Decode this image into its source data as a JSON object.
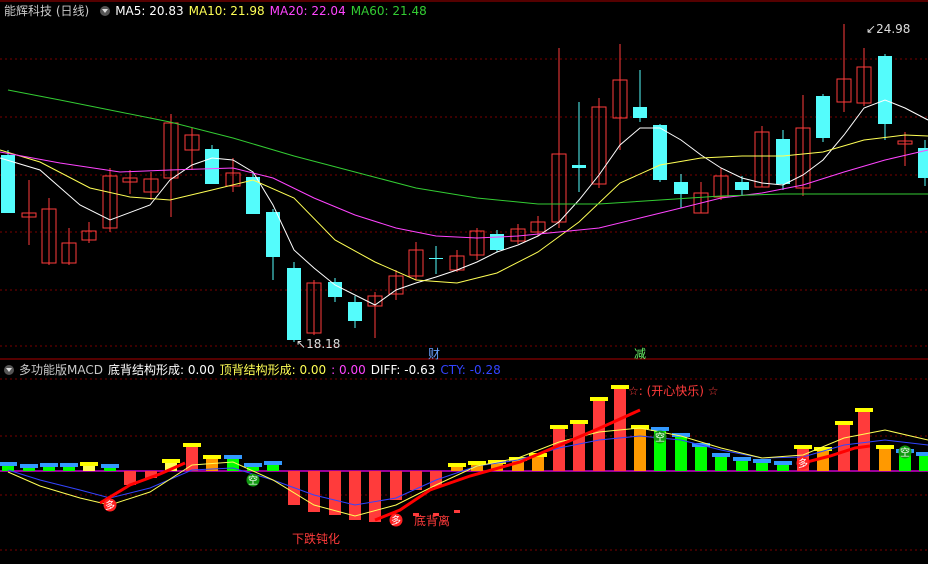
{
  "main": {
    "title": "能辉科技 (日线)",
    "ma": [
      {
        "label": "MA5: 20.83",
        "color": "#ffffff"
      },
      {
        "label": "MA10: 21.98",
        "color": "#ffff55"
      },
      {
        "label": "MA20: 22.04",
        "color": "#ff44ff"
      },
      {
        "label": "MA60: 21.48",
        "color": "#33cc33"
      }
    ],
    "high_label": "24.98",
    "low_label": "18.18",
    "markers": [
      {
        "text": "财",
        "color": "#6aa0ff"
      },
      {
        "text": "减",
        "color": "#66ee66"
      }
    ]
  },
  "sub": {
    "title": "多功能版MACD",
    "items": [
      {
        "label": "底背结构形成:",
        "value": "0.00",
        "color": "#ffffff"
      },
      {
        "label": "顶背结构形成:",
        "value": "0.00",
        "color": "#ffff55"
      },
      {
        "label": ":",
        "value": "0.00",
        "color": "#ff44ff"
      },
      {
        "label": "DIFF:",
        "value": "-0.63",
        "color": "#ffffff"
      },
      {
        "label": "CTY:",
        "value": "-0.28",
        "color": "#3344ff"
      }
    ],
    "annotations": {
      "top": "☆: (开心快乐) ☆",
      "slowdown": "下跌钝化",
      "bottom_div": "底背离",
      "duo": "多",
      "kong": "空"
    }
  },
  "colors": {
    "up": "#ff3b3b",
    "down": "#54fcfc",
    "bg": "#000000",
    "axis": "#aa0000"
  }
}
